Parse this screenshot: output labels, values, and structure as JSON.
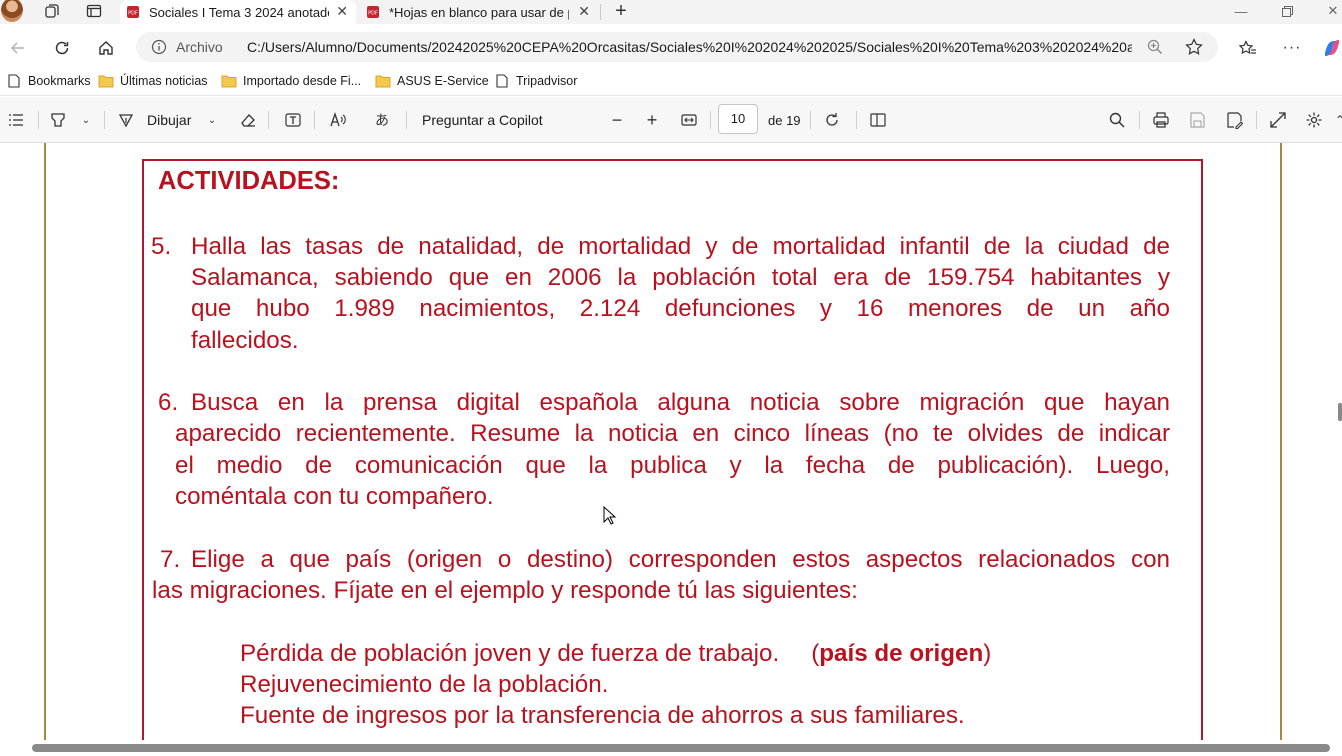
{
  "browser": {
    "tabs": [
      {
        "title": "Sociales I Tema 3 2024 anotado.p",
        "active": true
      },
      {
        "title": "*Hojas en blanco para usar de piz",
        "active": false
      }
    ],
    "address": {
      "label": "Archivo",
      "url": "C:/Users/Alumno/Documents/20242025%20CEPA%20Orcasitas/Sociales%20I%202024%202025/Sociales%20I%20Tema%203%202024%20ano..."
    },
    "bookmarks": [
      {
        "label": "Bookmarks",
        "icon": "document-icon"
      },
      {
        "label": "Últimas noticias",
        "icon": "folder-icon"
      },
      {
        "label": "Importado desde Fi...",
        "icon": "folder-icon"
      },
      {
        "label": "ASUS E-Service",
        "icon": "folder-icon"
      },
      {
        "label": "Tripadvisor",
        "icon": "document-icon"
      }
    ]
  },
  "pdf_toolbar": {
    "draw_label": "Dibujar",
    "copilot_label": "Preguntar a Copilot",
    "page_current": "10",
    "page_total": "de 19"
  },
  "document": {
    "heading": "ACTIVIDADES:",
    "q5": {
      "number": "5.",
      "lines": [
        "Halla las tasas de natalidad, de mortalidad y de mortalidad infantil de la ciudad de",
        "Salamanca, sabiendo que en 2006 la población total era de 159.754 habitantes y",
        "que hubo 1.989 nacimientos, 2.124 defunciones y 16 menores de un año",
        "fallecidos."
      ]
    },
    "q6": {
      "number": "6.",
      "lines": [
        "Busca en la prensa digital española alguna noticia sobre migración que hayan",
        "aparecido recientemente. Resume la noticia en cinco líneas (no te olvides de indicar",
        "el medio de comunicación que la publica y la fecha de publicación). Luego,",
        "coméntala con tu compañero."
      ]
    },
    "q7": {
      "number": "7.",
      "lines": [
        "Elige a que país (origen o destino) corresponden estos aspectos relacionados con",
        "las migraciones. Fíjate en el ejemplo y responde tú las siguientes:"
      ]
    },
    "items": [
      {
        "text": "Pérdida de población joven y de fuerza de trabajo.",
        "answer": "país de origen"
      },
      {
        "text": "Rejuvenecimiento de la población."
      },
      {
        "text": "Fuente de ingresos por la transferencia de ahorros a sus familiares."
      }
    ]
  },
  "colors": {
    "doc_text": "#b8121f",
    "frame": "#b2182b",
    "page_border": "#a08a48"
  }
}
